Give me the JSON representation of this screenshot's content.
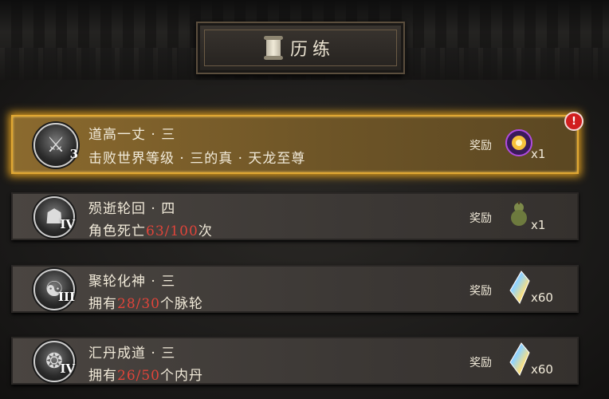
{
  "header": {
    "title": "历练"
  },
  "tasks": [
    {
      "name": "道高一丈 · 三",
      "desc_prefix": "击败世界等级 · 三的真 · 天龙至尊",
      "progress": "",
      "progress_total": "",
      "desc_suffix": "",
      "tier": "3",
      "reward_label": "奖励",
      "reward_qty": "x1",
      "reward_icon": "glowing-orb-icon",
      "alert": "!"
    },
    {
      "name": "殒逝轮回 · 四",
      "desc_prefix": "角色死亡",
      "progress": "63",
      "progress_total": "/100",
      "desc_suffix": "次",
      "tier": "IV",
      "reward_label": "奖励",
      "reward_qty": "x1",
      "reward_icon": "gourd-icon"
    },
    {
      "name": "聚轮化神 · 三",
      "desc_prefix": "拥有",
      "progress": "28",
      "progress_total": "/30",
      "desc_suffix": "个脉轮",
      "tier": "III",
      "reward_label": "奖励",
      "reward_qty": "x60",
      "reward_icon": "rainbow-crystal-icon"
    },
    {
      "name": "汇丹成道 · 三",
      "desc_prefix": "拥有",
      "progress": "26",
      "progress_total": "/50",
      "desc_suffix": "个内丹",
      "tier": "IV",
      "reward_label": "奖励",
      "reward_qty": "x60",
      "reward_icon": "rainbow-crystal-icon"
    }
  ],
  "colors": {
    "highlight_border": "#e0a733",
    "progress_red": "#e0443a"
  }
}
